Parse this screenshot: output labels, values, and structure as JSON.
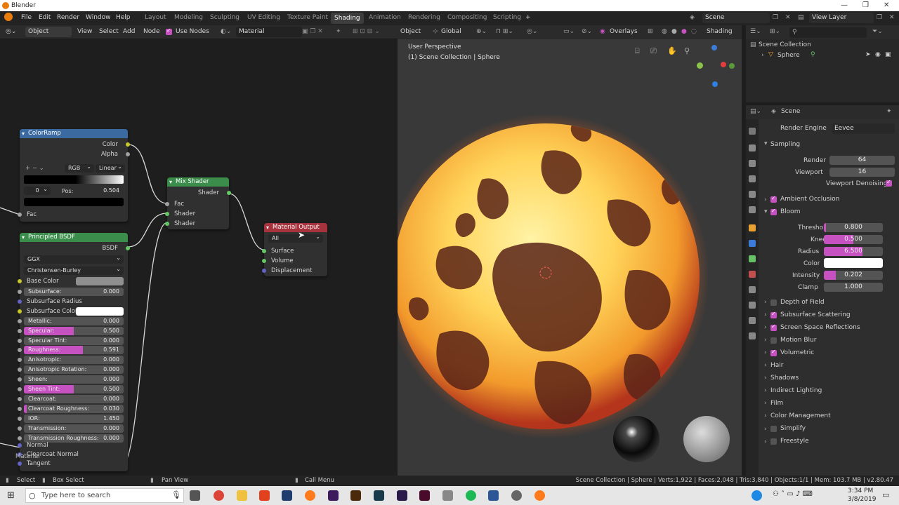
{
  "window": {
    "title": "Blender"
  },
  "menu": {
    "items": [
      "File",
      "Edit",
      "Render",
      "Window",
      "Help"
    ]
  },
  "workspaces": [
    "Layout",
    "Modeling",
    "Sculpting",
    "UV Editing",
    "Texture Paint",
    "Shading",
    "Animation",
    "Rendering",
    "Compositing",
    "Scripting"
  ],
  "active_workspace": "Shading",
  "scene_field": "Scene",
  "view_layer_field": "View Layer",
  "node_editor": {
    "mode": "Object",
    "menus": [
      "View",
      "Select",
      "Add",
      "Node"
    ],
    "use_nodes_label": "Use Nodes",
    "material_field": "Material",
    "corner_label": "Material"
  },
  "nodes": {
    "colorramp": {
      "title": "ColorRamp",
      "out_color": "Color",
      "out_alpha": "Alpha",
      "mode": "RGB",
      "interp": "Linear",
      "index": "0",
      "pos_label": "Pos:",
      "pos_value": "0.504",
      "in_fac": "Fac"
    },
    "mix": {
      "title": "Mix Shader",
      "out": "Shader",
      "in_fac": "Fac",
      "in_shader1": "Shader",
      "in_shader2": "Shader"
    },
    "output": {
      "title": "Material Output",
      "target": "All",
      "surface": "Surface",
      "volume": "Volume",
      "displacement": "Displacement"
    },
    "bsdf": {
      "title": "Principled BSDF",
      "out": "BSDF",
      "distribution": "GGX",
      "sss_method": "Christensen-Burley",
      "base_color": "Base Color",
      "rows": [
        {
          "label": "Subsurface:",
          "value": "0.000",
          "fill": 0
        },
        {
          "label": "Subsurface Radius",
          "value": "",
          "fill": -1
        },
        {
          "label": "Subsurface Color",
          "value": "",
          "fill": -2
        },
        {
          "label": "Metallic:",
          "value": "0.000",
          "fill": 0
        },
        {
          "label": "Specular:",
          "value": "0.500",
          "fill": 0.5
        },
        {
          "label": "Specular Tint:",
          "value": "0.000",
          "fill": 0
        },
        {
          "label": "Roughness:",
          "value": "0.591",
          "fill": 0.591
        },
        {
          "label": "Anisotropic:",
          "value": "0.000",
          "fill": 0
        },
        {
          "label": "Anisotropic Rotation:",
          "value": "0.000",
          "fill": 0
        },
        {
          "label": "Sheen:",
          "value": "0.000",
          "fill": 0
        },
        {
          "label": "Sheen Tint:",
          "value": "0.500",
          "fill": 0.5
        },
        {
          "label": "Clearcoat:",
          "value": "0.000",
          "fill": 0
        },
        {
          "label": "Clearcoat Roughness:",
          "value": "0.030",
          "fill": 0.03
        },
        {
          "label": "IOR:",
          "value": "1.450",
          "fill": 0
        },
        {
          "label": "Transmission:",
          "value": "0.000",
          "fill": 0
        },
        {
          "label": "Transmission Roughness:",
          "value": "0.000",
          "fill": 0
        }
      ],
      "normal": "Normal",
      "clearcoat_normal": "Clearcoat Normal",
      "tangent": "Tangent"
    }
  },
  "viewport": {
    "header": {
      "mode": "Object",
      "orientation": "Global",
      "overlays": "Overlays",
      "shading": "Shading"
    },
    "perspective": "User Perspective",
    "collection_info": "(1) Scene Collection | Sphere"
  },
  "outliner": {
    "collection": "Scene Collection",
    "object": "Sphere"
  },
  "properties": {
    "scene_label": "Scene",
    "render_engine_label": "Render Engine",
    "render_engine": "Eevee",
    "sampling": "Sampling",
    "render_label": "Render",
    "render_value": "64",
    "viewport_label": "Viewport",
    "viewport_value": "16",
    "viewport_denoising": "Viewport Denoising",
    "ambient_occlusion": "Ambient Occlusion",
    "bloom": "Bloom",
    "threshold_label": "Threshold",
    "threshold_value": "0.800",
    "knee_label": "Knee",
    "knee_value": "0.500",
    "radius_label": "Radius",
    "radius_value": "6.500",
    "color_label": "Color",
    "intensity_label": "Intensity",
    "intensity_value": "0.202",
    "clamp_label": "Clamp",
    "clamp_value": "1.000",
    "panels": [
      {
        "label": "Depth of Field",
        "checked": false
      },
      {
        "label": "Subsurface Scattering",
        "checked": true
      },
      {
        "label": "Screen Space Reflections",
        "checked": true
      },
      {
        "label": "Motion Blur",
        "checked": false
      },
      {
        "label": "Volumetric",
        "checked": true
      }
    ],
    "sections": [
      "Hair",
      "Shadows",
      "Indirect Lighting",
      "Film",
      "Color Management"
    ],
    "simplify": "Simplify",
    "freestyle": "Freestyle"
  },
  "status": {
    "select": "Select",
    "box_select": "Box Select",
    "pan_view": "Pan View",
    "call_menu": "Call Menu",
    "stats": "Scene Collection | Sphere | Verts:1,922 | Faces:2,048 | Tris:3,840 | Objects:1/1 | Mem: 103.7 MB | v2.80.47"
  },
  "taskbar": {
    "search_placeholder": "Type here to search",
    "time": "3:34 PM",
    "date": "3/8/2019"
  },
  "colors": {
    "accent": "#c651c0",
    "colorramp_header": "#3b6aa0",
    "mix_header": "#3a8d4a",
    "bsdf_header": "#3a8d4a",
    "output_header": "#a5323d",
    "lava_bright": "#ffe27a",
    "lava_dark": "#5a2418"
  }
}
